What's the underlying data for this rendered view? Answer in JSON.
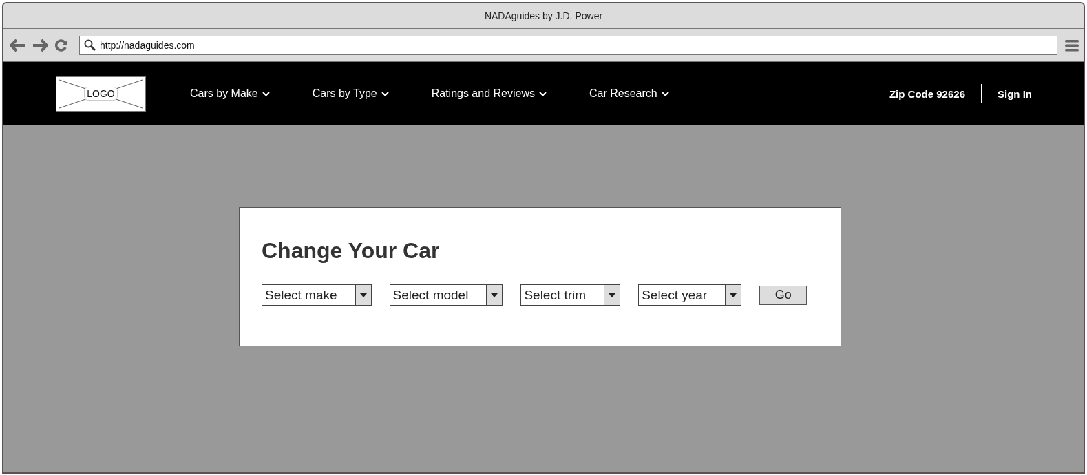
{
  "window": {
    "title": "NADAguides by J.D. Power"
  },
  "address_bar": {
    "value": "http://nadaguides.com"
  },
  "header": {
    "logo": "LOGO",
    "nav": [
      {
        "label": "Cars by Make"
      },
      {
        "label": "Cars by Type"
      },
      {
        "label": "Ratings and Reviews"
      },
      {
        "label": "Car Research"
      }
    ],
    "zip_code": "Zip Code 92626",
    "sign_in": "Sign In"
  },
  "card": {
    "title": "Change Your Car",
    "selects": [
      {
        "placeholder": "Select make"
      },
      {
        "placeholder": "Select model"
      },
      {
        "placeholder": "Select trim"
      },
      {
        "placeholder": "Select year"
      }
    ],
    "button": "Go"
  }
}
